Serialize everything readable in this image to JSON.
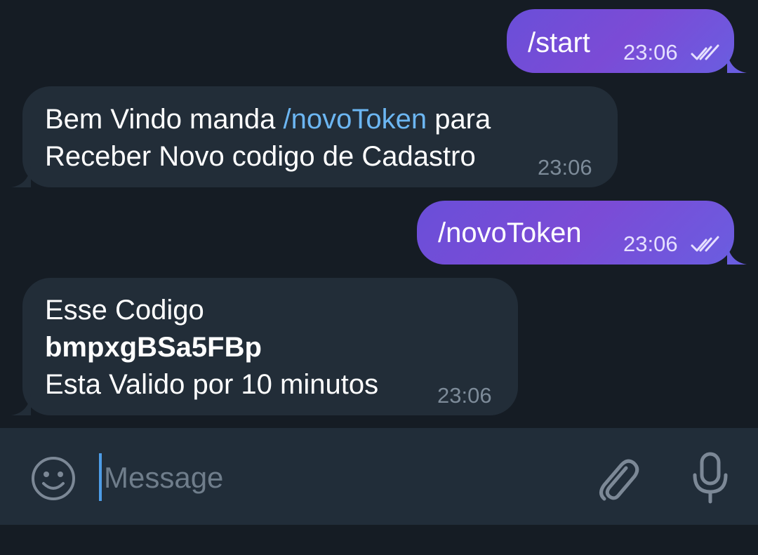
{
  "messages": [
    {
      "direction": "out",
      "text": "/start",
      "time": "23:06",
      "status": "read"
    },
    {
      "direction": "in",
      "line1_pre": "Bem Vindo manda ",
      "line1_link": "/novoToken",
      "line1_post": " para",
      "line2": "Receber Novo codigo de Cadastro",
      "time": "23:06"
    },
    {
      "direction": "out",
      "text": "/novoToken",
      "time": "23:06",
      "status": "read"
    },
    {
      "direction": "in",
      "line1": "Esse Codigo",
      "code": "bmpxgBSa5FBp",
      "line3": "Esta Valido por 10 minutos",
      "time": "23:06"
    }
  ],
  "composer": {
    "placeholder": "Message",
    "value": ""
  },
  "icons": {
    "emoji": "emoji-icon",
    "attach": "paperclip-icon",
    "mic": "microphone-icon",
    "read": "double-check-icon"
  },
  "colors": {
    "outgoing_bubble": "#7050dc",
    "incoming_bubble": "#222d38",
    "link": "#6cb6f2",
    "background": "#151c24",
    "input_bar": "#212d39"
  }
}
